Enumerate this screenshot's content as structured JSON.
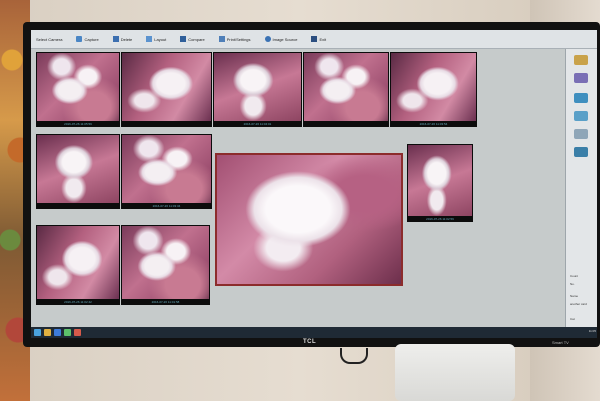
{
  "toolbar": {
    "items": [
      {
        "label": "Select Camera",
        "icon": "camera-select-icon"
      },
      {
        "label": "Capture",
        "icon": "capture-icon"
      },
      {
        "label": "Delete",
        "icon": "delete-icon"
      },
      {
        "label": "Layout",
        "icon": "layout-icon"
      },
      {
        "label": "Compare",
        "icon": "compare-icon"
      },
      {
        "label": "Print/Settings",
        "icon": "print-icon"
      },
      {
        "label": "Image Source",
        "icon": "image-source-icon"
      },
      {
        "label": "Exit",
        "icon": "exit-icon"
      }
    ]
  },
  "thumbnails": [
    {
      "caption": "2016-07-26 11:05:59"
    },
    {
      "caption": ""
    },
    {
      "caption": "2016-07-26 11:04:01"
    },
    {
      "caption": ""
    },
    {
      "caption": "2016-07-26 11:03:54"
    },
    {
      "caption": ""
    },
    {
      "caption": "2016-07-26 11:03:34"
    },
    {
      "caption": "2016-07-26 11:02:59"
    },
    {
      "caption": "2016-07-26 11:02:42"
    },
    {
      "caption": "2016-07-26 11:01:58"
    }
  ],
  "sidebar": {
    "labels": [
      "Count",
      "No.",
      "Name",
      "another card",
      "Cat"
    ],
    "icons": [
      "gear-icon",
      "user-icon",
      "camera-icon",
      "edit-icon",
      "print-icon",
      "export-icon"
    ]
  },
  "taskbar": {
    "clock": "11:05"
  },
  "tv": {
    "brand": "TCL",
    "model": "Smart TV"
  },
  "colors": {
    "gum": "#c0708e",
    "tooth": "#f4eff2",
    "selection": "#8c2c2c",
    "toolbar": "#dfe3e6"
  }
}
